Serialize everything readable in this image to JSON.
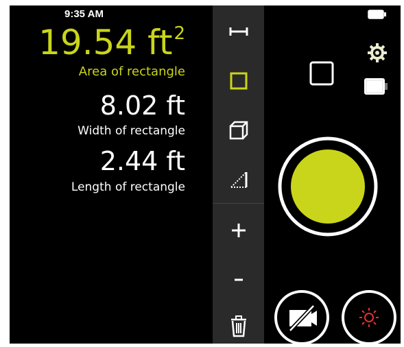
{
  "status_bar": {
    "time": "9:35 AM"
  },
  "readout": {
    "area": {
      "value": "19.54",
      "unit": "ft",
      "superscript": "2",
      "label": "Area of rectangle"
    },
    "width": {
      "value": "8.02",
      "unit": "ft",
      "label": "Width of rectangle"
    },
    "length": {
      "value": "2.44",
      "unit": "ft",
      "label": "Length of rectangle"
    }
  },
  "toolbar": {
    "tools": [
      "line-measure-icon",
      "rectangle-icon",
      "cube-icon",
      "angle-icon"
    ],
    "selected_tool": "rectangle-icon",
    "actions": [
      "plus-icon",
      "minus-icon",
      "trash-icon"
    ]
  },
  "controls": {
    "icons": [
      "settings-gear-icon",
      "battery-icon",
      "current-shape-square-icon",
      "shutter-button",
      "camera-off-icon",
      "laser-icon"
    ]
  },
  "colors": {
    "accent": "#c9d51a",
    "toolbar_bg": "#2a2a2a",
    "background": "#000000",
    "laser": "#e8322b"
  }
}
